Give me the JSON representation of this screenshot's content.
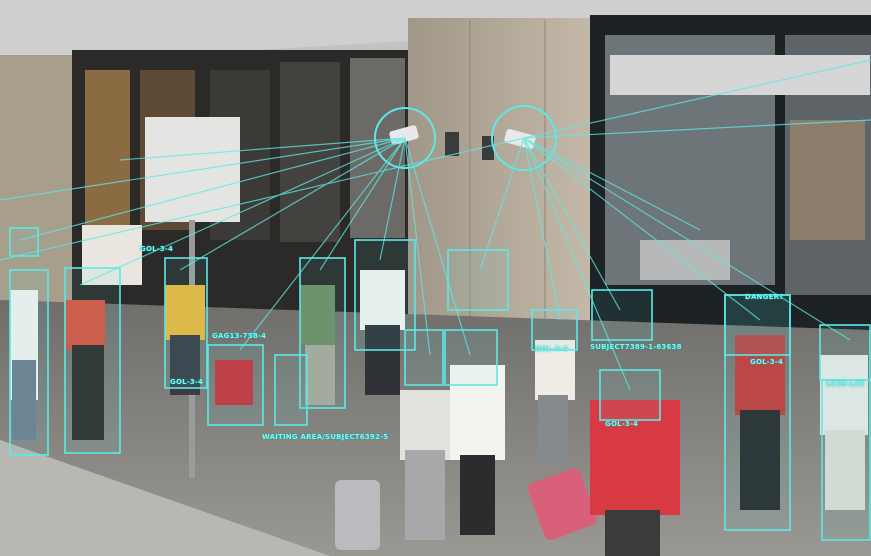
{
  "image": {
    "description_tags": [
      "street-scene",
      "surveillance",
      "face-recognition-overlay"
    ],
    "overlay_color": "#5ce9e6",
    "labels": [
      "DANGER?",
      "GAG13-758-4",
      "SUBJECT7389-1-63638",
      "WAITING AREA/SUBJECT6392-5",
      "LCS9-L29",
      "GOL-3-4",
      "GOL-3-4",
      "GOL-3-4",
      "GOL-3-4",
      "GOL-3-4"
    ]
  }
}
